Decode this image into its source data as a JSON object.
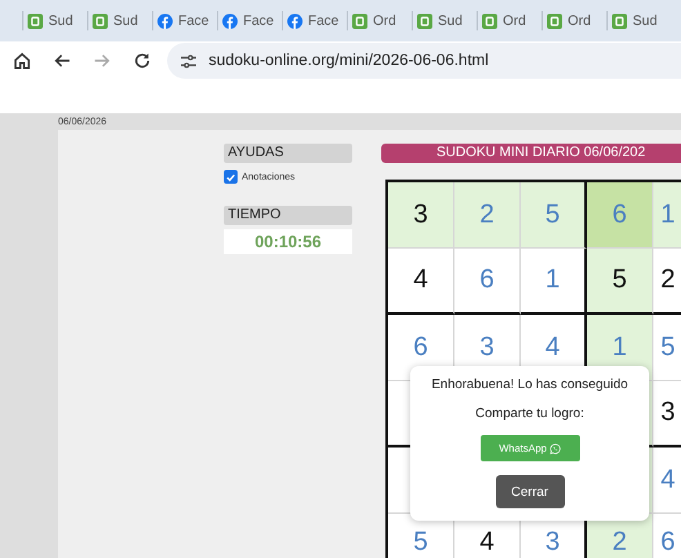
{
  "browser": {
    "tabs": [
      {
        "kind": "sudoku",
        "title": "Sud"
      },
      {
        "kind": "sudoku",
        "title": "Sud"
      },
      {
        "kind": "facebook",
        "title": "Face"
      },
      {
        "kind": "facebook",
        "title": "Face"
      },
      {
        "kind": "facebook",
        "title": "Face"
      },
      {
        "kind": "sudoku",
        "title": "Ord"
      },
      {
        "kind": "sudoku",
        "title": "Sud"
      },
      {
        "kind": "sudoku",
        "title": "Ord"
      },
      {
        "kind": "sudoku",
        "title": "Ord"
      },
      {
        "kind": "sudoku",
        "title": "Sud"
      }
    ],
    "url": "sudoku-online.org/mini/2026-06-06.html"
  },
  "page": {
    "date": "06/06/2026",
    "aids": {
      "heading": "AYUDAS",
      "notes": {
        "label": "Anotaciones",
        "checked": true
      }
    },
    "timer": {
      "heading": "TIEMPO",
      "time": "00:10:56"
    },
    "title": "SUDOKU MINI DIARIO 06/06/202",
    "board": {
      "rows": [
        [
          {
            "value": "3",
            "given": true,
            "selected": false
          },
          {
            "value": "2",
            "given": false,
            "selected": false
          },
          {
            "value": "5",
            "given": false,
            "selected": false
          },
          {
            "value": "6",
            "given": false,
            "selected": true
          },
          {
            "value": "1",
            "given": false,
            "selected": false
          }
        ],
        [
          {
            "value": "4",
            "given": true,
            "selected": false
          },
          {
            "value": "6",
            "given": false,
            "selected": false
          },
          {
            "value": "1",
            "given": false,
            "selected": false
          },
          {
            "value": "5",
            "given": true,
            "selected": false
          },
          {
            "value": "2",
            "given": true,
            "selected": false
          }
        ],
        [
          {
            "value": "6",
            "given": false,
            "selected": false
          },
          {
            "value": "3",
            "given": false,
            "selected": false
          },
          {
            "value": "4",
            "given": false,
            "selected": false
          },
          {
            "value": "1",
            "given": false,
            "selected": false
          },
          {
            "value": "5",
            "given": false,
            "selected": false
          }
        ],
        [
          {},
          {},
          {},
          {},
          {
            "value": "3",
            "given": true,
            "selected": false
          }
        ],
        [
          {},
          {},
          {},
          {},
          {
            "value": "4",
            "given": false,
            "selected": false
          }
        ],
        [
          {
            "value": "5",
            "given": false,
            "selected": false
          },
          {
            "value": "4",
            "given": true,
            "selected": false
          },
          {
            "value": "3",
            "given": false,
            "selected": false
          },
          {
            "value": "2",
            "given": false,
            "selected": false
          },
          {
            "value": "6",
            "given": false,
            "selected": false
          }
        ]
      ]
    }
  },
  "dialog": {
    "message": "Enhorabuena! Lo has conseguido",
    "share_label": "Comparte tu logro:",
    "share_button": "WhatsApp",
    "close_button": "Cerrar"
  }
}
